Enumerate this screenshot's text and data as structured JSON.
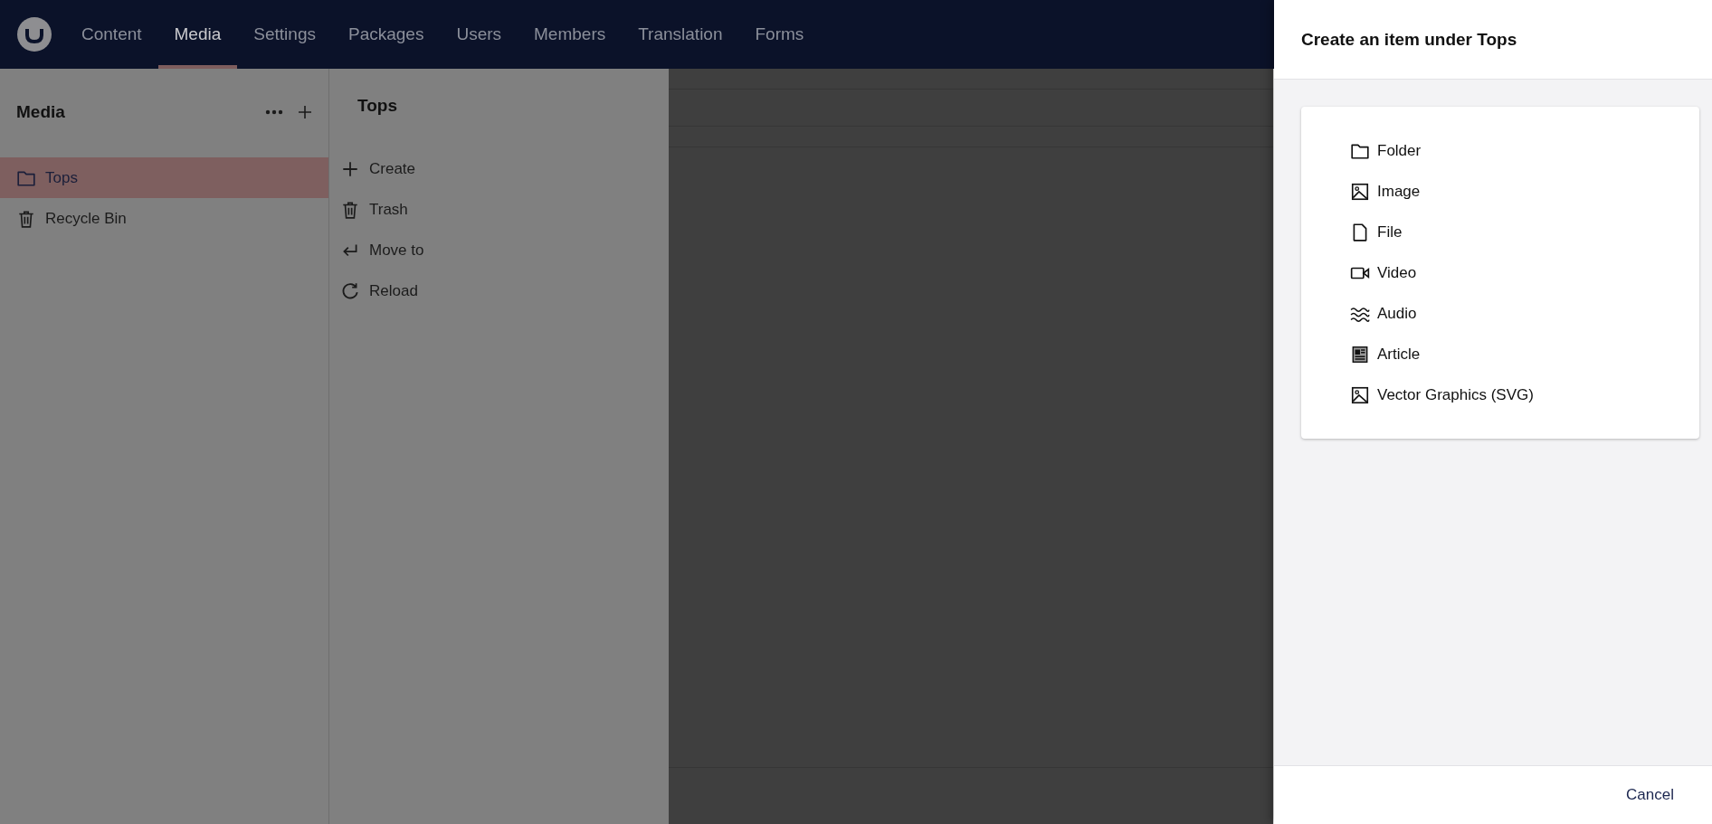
{
  "nav": [
    {
      "label": "Content",
      "selected": false
    },
    {
      "label": "Media",
      "selected": true
    },
    {
      "label": "Settings",
      "selected": false
    },
    {
      "label": "Packages",
      "selected": false
    },
    {
      "label": "Users",
      "selected": false
    },
    {
      "label": "Members",
      "selected": false
    },
    {
      "label": "Translation",
      "selected": false
    },
    {
      "label": "Forms",
      "selected": false
    }
  ],
  "sidebar": {
    "title": "Media",
    "items": [
      {
        "label": "Tops",
        "selected": true
      },
      {
        "label": "Recycle Bin",
        "selected": false
      }
    ]
  },
  "actions": {
    "title": "Tops",
    "items": [
      "Create",
      "Trash",
      "Move to",
      "Reload"
    ]
  },
  "dialog": {
    "title": "Create an item under Tops",
    "options": [
      "Folder",
      "Image",
      "File",
      "Video",
      "Audio",
      "Article",
      "Vector Graphics (SVG)"
    ],
    "cancel": "Cancel"
  }
}
